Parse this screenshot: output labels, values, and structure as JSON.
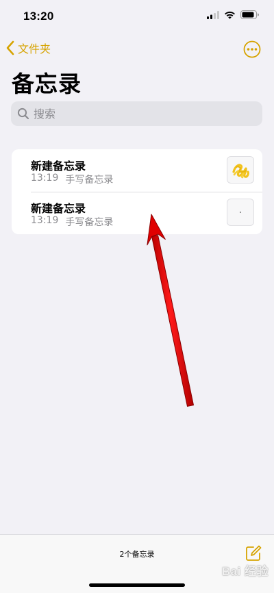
{
  "status_bar": {
    "time": "13:20",
    "icons": [
      "cellular-signal-icon",
      "wifi-icon",
      "battery-icon"
    ]
  },
  "nav": {
    "back_label": "文件夹",
    "back_icon": "chevron-left-icon",
    "more_icon": "ellipsis-circle-icon"
  },
  "page_title": "备忘录",
  "search": {
    "placeholder": "搜索",
    "value": ""
  },
  "notes": [
    {
      "title": "新建备忘录",
      "time": "13:19",
      "subtitle": "手写备忘录",
      "thumbnail": "yellow-scribble-drawing"
    },
    {
      "title": "新建备忘录",
      "time": "13:19",
      "subtitle": "手写备忘录",
      "thumbnail": "blank-drawing-dot"
    }
  ],
  "footer": {
    "count_text": "2个备忘录",
    "compose_icon": "compose-icon"
  },
  "watermark": {
    "text": "Bai 经验"
  },
  "colors": {
    "accent": "#d6a300",
    "background": "#f2f1f6",
    "annotation_arrow": "#e00000",
    "scribble": "#f2c21b"
  }
}
